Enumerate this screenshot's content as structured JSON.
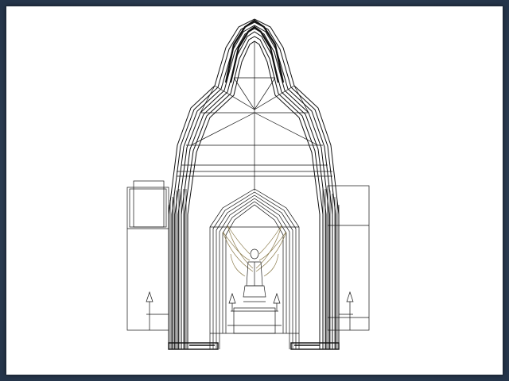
{
  "viewport": {
    "view_type": "wireframe",
    "subject": "cathedral",
    "colors": {
      "frame": "#2f3f52",
      "background": "#ffffff",
      "wire": "#000000",
      "statue": "#8a7a4a"
    }
  }
}
